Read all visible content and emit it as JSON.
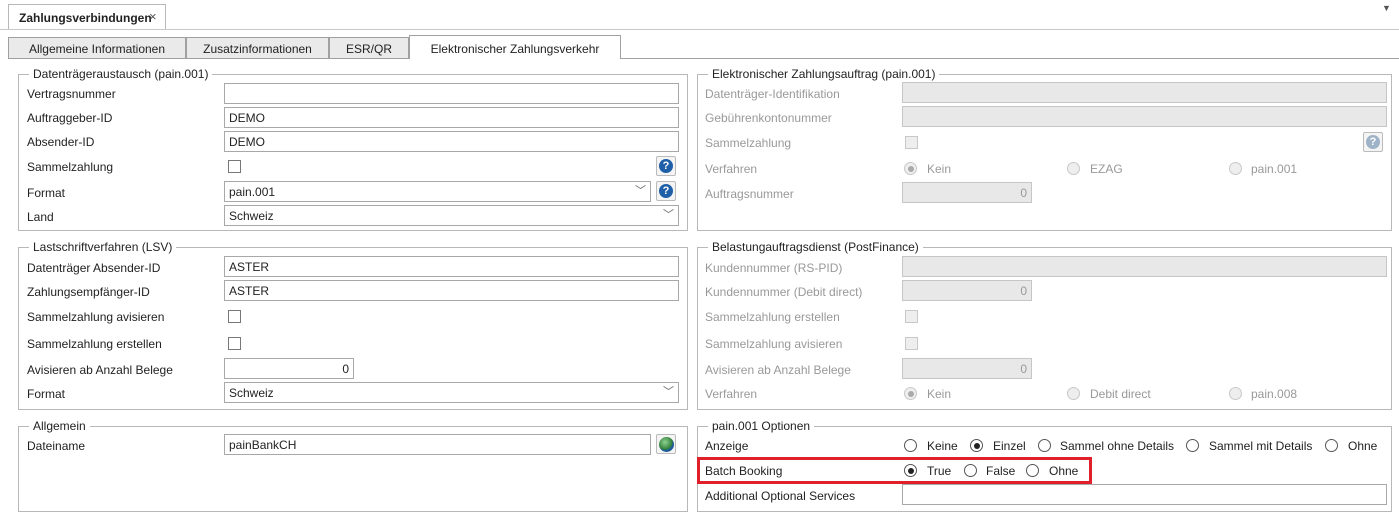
{
  "document_tab": {
    "title": "Zahlungsverbindungen",
    "close": "×"
  },
  "tabs": [
    "Allgemeine Informationen",
    "Zusatzinformationen",
    "ESR/QR",
    "Elektronischer Zahlungsverkehr"
  ],
  "active_tab": "Elektronischer Zahlungsverkehr",
  "datentraeger": {
    "legend": "Datenträgeraustausch (pain.001)",
    "vertragsnummer_label": "Vertragsnummer",
    "vertragsnummer_value": "",
    "auftraggeber_label": "Auftraggeber-ID",
    "auftraggeber_value": "DEMO",
    "absender_label": "Absender-ID",
    "absender_value": "DEMO",
    "sammelzahlung_label": "Sammelzahlung",
    "sammelzahlung_checked": false,
    "format_label": "Format",
    "format_value": "pain.001",
    "land_label": "Land",
    "land_value": "Schweiz"
  },
  "auftrag": {
    "legend": "Elektronischer Zahlungsauftrag (pain.001)",
    "identifikation_label": "Datenträger-Identifikation",
    "identifikation_value": "",
    "gebuehren_label": "Gebührenkontonummer",
    "gebuehren_value": "",
    "sammelzahlung_label": "Sammelzahlung",
    "verfahren_label": "Verfahren",
    "verfahren_options": [
      "Kein",
      "EZAG",
      "pain.001"
    ],
    "verfahren_selected": "Kein",
    "auftragsnummer_label": "Auftragsnummer",
    "auftragsnummer_value": "0"
  },
  "lsv": {
    "legend": "Lastschriftverfahren (LSV)",
    "absender_label": "Datenträger Absender-ID",
    "absender_value": "ASTER",
    "empfaenger_label": "Zahlungsempfänger-ID",
    "empfaenger_value": "ASTER",
    "avisieren_label": "Sammelzahlung avisieren",
    "erstellen_label": "Sammelzahlung erstellen",
    "anzahl_label": "Avisieren ab Anzahl Belege",
    "anzahl_value": "0",
    "format_label": "Format",
    "format_value": "Schweiz"
  },
  "postfinance": {
    "legend": "Belastungauftragsdienst (PostFinance)",
    "rs_label": "Kundennummer (RS-PID)",
    "rs_value": "",
    "dd_label": "Kundennummer (Debit direct)",
    "dd_value": "0",
    "erstellen_label": "Sammelzahlung erstellen",
    "avisieren_label": "Sammelzahlung avisieren",
    "anzahl_label": "Avisieren ab Anzahl Belege",
    "anzahl_value": "0",
    "verfahren_label": "Verfahren",
    "verfahren_options": [
      "Kein",
      "Debit direct",
      "pain.008"
    ],
    "verfahren_selected": "Kein"
  },
  "allgemein": {
    "legend": "Allgemein",
    "dateiname_label": "Dateiname",
    "dateiname_value": "painBankCH"
  },
  "optionen": {
    "legend": "pain.001 Optionen",
    "anzeige_label": "Anzeige",
    "anzeige_options": [
      "Keine",
      "Einzel",
      "Sammel ohne Details",
      "Sammel mit Details",
      "Ohne"
    ],
    "anzeige_selected": "Einzel",
    "batch_label": "Batch Booking",
    "batch_options": [
      "True",
      "False",
      "Ohne"
    ],
    "batch_selected": "True",
    "services_label": "Additional Optional Services",
    "services_value": ""
  },
  "colors": {
    "highlight": "#e0202a",
    "help_icon": "#1e5fa8"
  }
}
